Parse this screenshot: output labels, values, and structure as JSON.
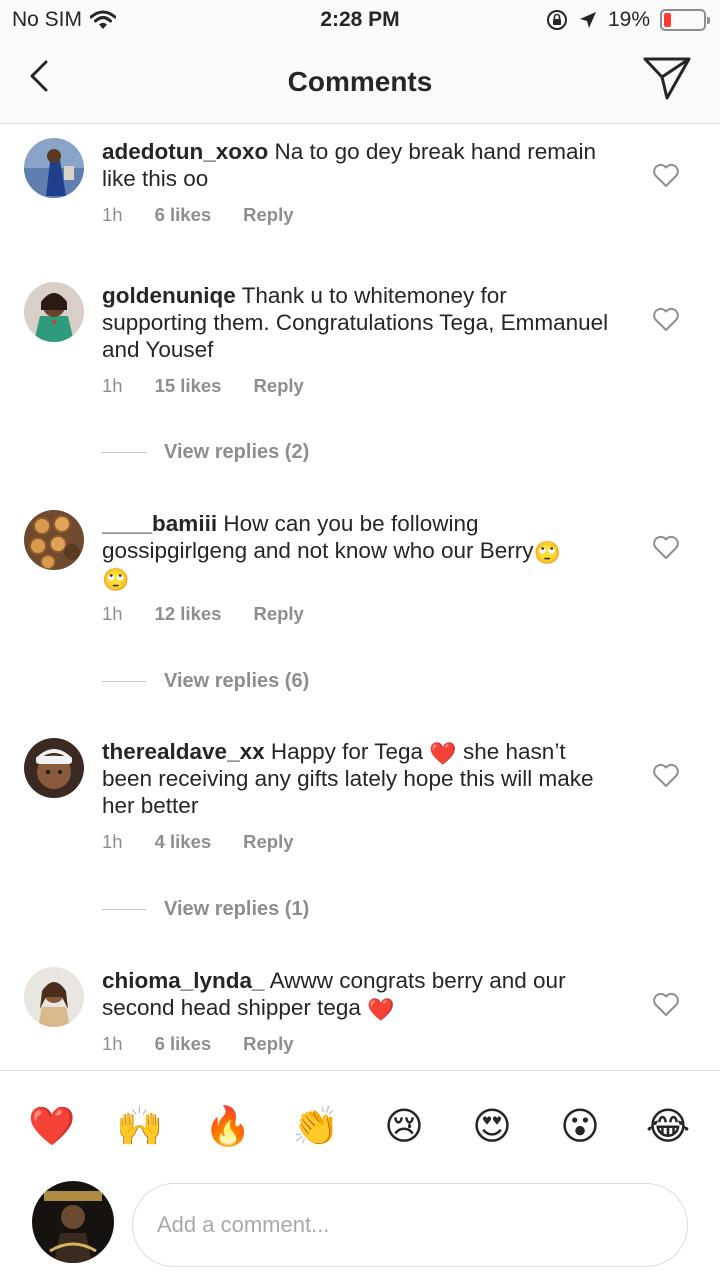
{
  "status_bar": {
    "carrier": "No SIM",
    "time": "2:28 PM",
    "battery": "19%",
    "battery_level": 0.19
  },
  "nav": {
    "title": "Comments"
  },
  "comments": [
    {
      "username": "adedotun_xoxo",
      "text": "Na to go dey break hand remain like this oo",
      "time": "1h",
      "likes": "6 likes",
      "reply": "Reply"
    },
    {
      "username": "goldenuniqe",
      "text": "Thank u to whitemoney for supporting them. Congratulations Tega, Emmanuel and Yousef",
      "time": "1h",
      "likes": "15 likes",
      "reply": "Reply",
      "view_replies": "View replies (2)"
    },
    {
      "username": "____bamiii",
      "text": "How can you be following gossipgirlgeng and not know who our Berry",
      "emoji": "🙄",
      "emoji2": "🙄",
      "time": "1h",
      "likes": "12 likes",
      "reply": "Reply",
      "view_replies": "View replies (6)"
    },
    {
      "username": "therealdave_xx",
      "text_a": "Happy for Tega",
      "emoji": "❤️",
      "text_b": "she hasn’t been receiving any gifts lately hope this will make her better",
      "time": "1h",
      "likes": "4 likes",
      "reply": "Reply",
      "view_replies": "View replies (1)"
    },
    {
      "username": "chioma_lynda_",
      "text": "Awww congrats berry and our second head shipper tega",
      "emoji": "❤️",
      "time": "1h",
      "likes": "6 likes",
      "reply": "Reply"
    }
  ],
  "reactions": [
    "❤️",
    "🙌",
    "🔥",
    "👏",
    "😢",
    "😍",
    "😮",
    "😂"
  ],
  "composer": {
    "placeholder": "Add a comment..."
  },
  "icons": {
    "back": "chevron-left-icon",
    "send": "paper-plane-icon",
    "like": "heart-outline-icon"
  },
  "colors": {
    "text": "#262626",
    "secondary": "#8e8e8e",
    "battery": "#ff3b30"
  }
}
